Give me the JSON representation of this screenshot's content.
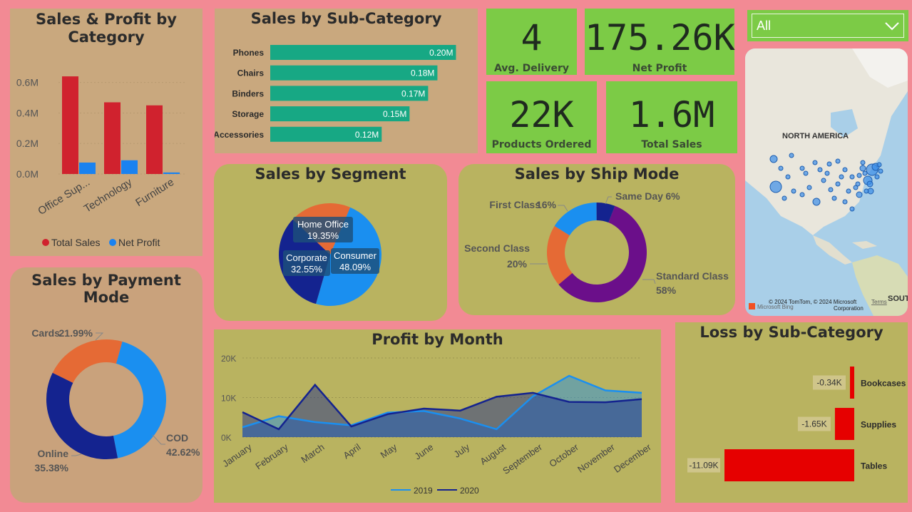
{
  "slicer": {
    "selected": "All"
  },
  "kpis": {
    "avg_delivery": {
      "value": "4",
      "label": "Avg. Delivery"
    },
    "net_profit": {
      "value": "175.26K",
      "label": "Net Profit"
    },
    "products_ordered": {
      "value": "22K",
      "label": "Products Ordered"
    },
    "total_sales": {
      "value": "1.6M",
      "label": "Total Sales"
    }
  },
  "map": {
    "region_label": "NORTH AMERICA",
    "south_label": "SOUTH",
    "attribution": "© 2024 TomTom, © 2024 Microsoft Corporation",
    "attribution_1": "© 2024 TomTom, © 2024 Microsoft",
    "attribution_2": "Corporation",
    "terms": "Terms",
    "bing": "Microsoft Bing"
  },
  "colors": {
    "total_sales": "#d0222e",
    "net_profit": "#1a82f0",
    "teal": "#17a884",
    "series_2019": "#1a8ff0",
    "series_2020": "#14238f",
    "loss": "#e60000"
  },
  "chart_data": [
    {
      "id": "category",
      "type": "bar",
      "title": "Sales & Profit by Category",
      "title_lines": [
        "Sales & Profit by",
        "Category"
      ],
      "categories": [
        "Office Sup...",
        "Technology",
        "Furniture"
      ],
      "series": [
        {
          "name": "Total Sales",
          "values": [
            0.64,
            0.47,
            0.45
          ]
        },
        {
          "name": "Net Profit",
          "values": [
            0.075,
            0.09,
            0.01
          ]
        }
      ],
      "y_ticks": [
        "0.0M",
        "0.2M",
        "0.4M",
        "0.6M"
      ],
      "ylim": [
        0,
        0.72
      ],
      "legend_position": "bottom"
    },
    {
      "id": "subcategory",
      "type": "bar",
      "orientation": "horizontal",
      "title": "Sales by Sub-Category",
      "categories": [
        "Phones",
        "Chairs",
        "Binders",
        "Storage",
        "Accessories"
      ],
      "values": [
        0.2,
        0.18,
        0.17,
        0.15,
        0.12
      ],
      "labels": [
        "0.20M",
        "0.18M",
        "0.17M",
        "0.15M",
        "0.12M"
      ],
      "xlim": [
        0,
        0.215
      ]
    },
    {
      "id": "segment",
      "type": "pie",
      "title": "Sales by Segment",
      "slices": [
        {
          "name": "Consumer",
          "value": 48.09,
          "label": "48.09%"
        },
        {
          "name": "Corporate",
          "value": 32.55,
          "label": "32.55%"
        },
        {
          "name": "Home Office",
          "value": 19.35,
          "label": "19.35%"
        }
      ]
    },
    {
      "id": "shipmode",
      "type": "pie",
      "subtype": "donut",
      "title": "Sales by Ship Mode",
      "slices": [
        {
          "name": "Standard Class",
          "value": 58,
          "label": "58%"
        },
        {
          "name": "Second Class",
          "value": 20,
          "label": "20%"
        },
        {
          "name": "First Class",
          "value": 16,
          "label": "16%"
        },
        {
          "name": "Same Day",
          "value": 6,
          "label": "6%"
        }
      ]
    },
    {
      "id": "payment",
      "type": "pie",
      "subtype": "donut",
      "title": "Sales by Payment Mode",
      "slices": [
        {
          "name": "COD",
          "value": 42.62,
          "label": "42.62%"
        },
        {
          "name": "Online",
          "value": 35.38,
          "label": "35.38%"
        },
        {
          "name": "Cards",
          "value": 21.99,
          "label": "21.99%"
        }
      ]
    },
    {
      "id": "month",
      "type": "area",
      "title": "Profit by Month",
      "categories": [
        "January",
        "February",
        "March",
        "April",
        "May",
        "June",
        "July",
        "August",
        "September",
        "October",
        "November",
        "December"
      ],
      "series": [
        {
          "name": "2019",
          "values": [
            2.5,
            5.3,
            3.8,
            3.0,
            6.2,
            6.6,
            4.7,
            2.0,
            10.3,
            15.5,
            11.8,
            11.2
          ]
        },
        {
          "name": "2020",
          "values": [
            6.3,
            2.0,
            13.2,
            2.7,
            5.8,
            7.2,
            6.7,
            10.2,
            11.2,
            8.9,
            8.8,
            9.6
          ]
        }
      ],
      "y_ticks": [
        "0K",
        "10K",
        "20K"
      ],
      "ylim": [
        0,
        20
      ],
      "legend_position": "bottom"
    },
    {
      "id": "loss",
      "type": "bar",
      "orientation": "horizontal",
      "title": "Loss by Sub-Category",
      "categories": [
        "Bookcases",
        "Supplies",
        "Tables"
      ],
      "values": [
        -0.34,
        -1.65,
        -11.09
      ],
      "labels": [
        "-0.34K",
        "-1.65K",
        "-11.09K"
      ]
    }
  ]
}
